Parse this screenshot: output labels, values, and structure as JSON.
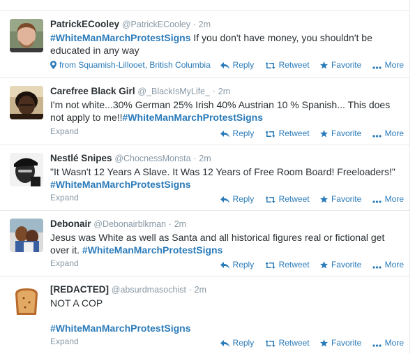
{
  "colors": {
    "link": "#2b7bb9",
    "meta": "#8899a6",
    "text": "#292f33"
  },
  "actions": {
    "reply": "Reply",
    "retweet": "Retweet",
    "favorite": "Favorite",
    "more": "More"
  },
  "expand_label": "Expand",
  "dot": "·",
  "tweets": [
    {
      "fullname": "PatrickECooley",
      "username": "@PatrickECooley",
      "time": "2m",
      "hashtag": "#WhiteManMarchProtestSigns",
      "text_after": " If you don't have money, you shouldn't be educated in any way",
      "location": "from Squamish-Lillooet, British Columbia"
    },
    {
      "fullname": "Carefree Black Girl",
      "username": "@_BlackIsMyLife_",
      "time": "2m",
      "text_before": "I'm not white...30% German 25% Irish 40% Austrian 10 % Spanish... This does not apply to me!!",
      "hashtag": "#WhiteManMarchProtestSigns"
    },
    {
      "fullname": "Nestlé Snipes",
      "username": "@ChocnessMonsta",
      "time": "2m",
      "text_before": "\"It Wasn't 12 Years A Slave. It Was 12 Years of Free Room Board! Freeloaders!\" ",
      "hashtag": "#WhiteManMarchProtestSigns"
    },
    {
      "fullname": "Debonair",
      "username": "@Debonairblkman",
      "time": "2m",
      "text_before": "Jesus was White as well as Santa and all historical figures real or fictional get over it. ",
      "hashtag": "#WhiteManMarchProtestSigns"
    },
    {
      "fullname": "[REDACTED]",
      "username": "@absurdmasochist",
      "time": "2m",
      "text_before": "NOT A COP",
      "hashtag": "#WhiteManMarchProtestSigns"
    }
  ]
}
